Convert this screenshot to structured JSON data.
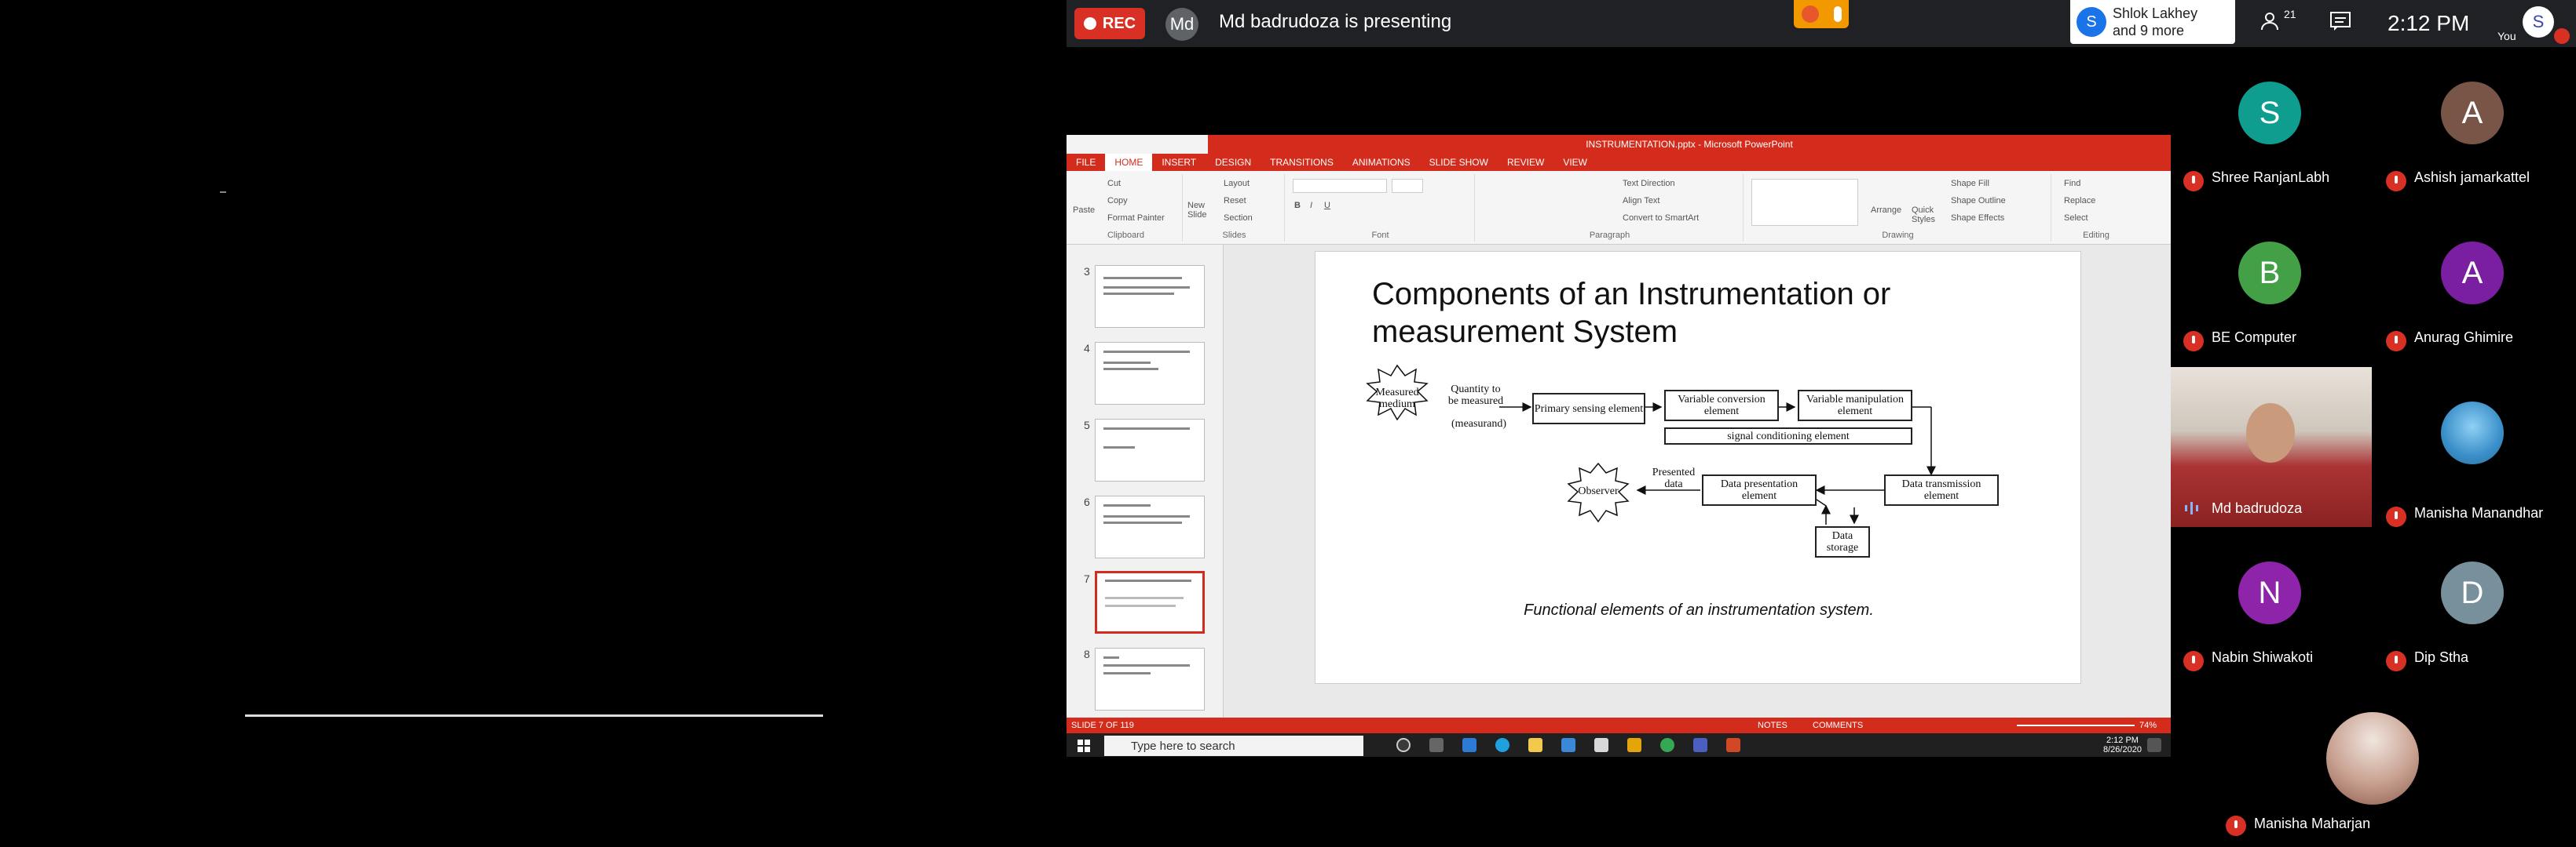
{
  "meet": {
    "rec_label": "REC",
    "presenter_initials": "Md",
    "presenter_text": "Md badrudoza is presenting",
    "participants_avatar": "S",
    "participants_line1": "Shlok Lakhey",
    "participants_line2": "and 9 more",
    "people_count": "21",
    "clock": "2:12 PM",
    "you_label": "You",
    "you_initial": "S"
  },
  "ppt": {
    "window_title": "INSTRUMENTATION.pptx - Microsoft PowerPoint",
    "tabs": [
      "FILE",
      "HOME",
      "INSERT",
      "DESIGN",
      "TRANSITIONS",
      "ANIMATIONS",
      "SLIDE SHOW",
      "REVIEW",
      "VIEW"
    ],
    "ribbon": {
      "paste": "Paste",
      "cut": "Cut",
      "copy": "Copy",
      "format_painter": "Format Painter",
      "clipboard": "Clipboard",
      "new_slide": "New Slide",
      "layout": "Layout",
      "reset": "Reset",
      "section": "Section",
      "slides": "Slides",
      "font": "Font",
      "text_direction": "Text Direction",
      "align_text": "Align Text",
      "convert_smartart": "Convert to SmartArt",
      "paragraph": "Paragraph",
      "arrange": "Arrange",
      "quick_styles": "Quick Styles",
      "shape_fill": "Shape Fill",
      "shape_outline": "Shape Outline",
      "shape_effects": "Shape Effects",
      "drawing": "Drawing",
      "find": "Find",
      "replace": "Replace",
      "select": "Select",
      "editing": "Editing"
    },
    "thumb_numbers": [
      "3",
      "4",
      "5",
      "6",
      "7",
      "8"
    ],
    "slide": {
      "title_line1": "Components of an Instrumentation or",
      "title_line2": "measurement System",
      "measured_medium": "Measured medium",
      "quantity": "Quantity to be measured",
      "measurand": "(measurand)",
      "primary": "Primary sensing element",
      "variable_conversion": "Variable conversion element",
      "variable_manipulation": "Variable manipulation element",
      "signal_conditioning": "signal conditioning element",
      "observer": "Observer",
      "presented_data": "Presented data",
      "data_presentation": "Data presentation element",
      "data_transmission": "Data transmission element",
      "data_storage": "Data storage",
      "caption": "Functional elements of an instrumentation system."
    },
    "status": {
      "slide_info": "SLIDE 7 OF 119",
      "notes": "NOTES",
      "comments": "COMMENTS",
      "zoom": "74%"
    },
    "taskbar": {
      "search_placeholder": "Type here to search",
      "time": "2:12 PM",
      "date": "8/26/2020"
    }
  },
  "participants": [
    {
      "initial": "S",
      "name": "Shree RanjanLabh",
      "color": "#0f9d8f"
    },
    {
      "initial": "A",
      "name": "Ashish jamarkattel",
      "color": "#795548"
    },
    {
      "initial": "B",
      "name": "BE Computer",
      "color": "#43a047"
    },
    {
      "initial": "A",
      "name": "Anurag Ghimire",
      "color": "#7b1fa2"
    },
    {
      "initial": "",
      "name": "Md badrudoza",
      "color": "#8a3030"
    },
    {
      "initial": "",
      "name": "Manisha Manandhar",
      "color": "#3a8fc9"
    },
    {
      "initial": "N",
      "name": "Nabin Shiwakoti",
      "color": "#8e24aa"
    },
    {
      "initial": "D",
      "name": "Dip Stha",
      "color": "#78909c"
    },
    {
      "initial": "",
      "name": "Manisha Maharjan",
      "color": "#c8a090"
    }
  ]
}
